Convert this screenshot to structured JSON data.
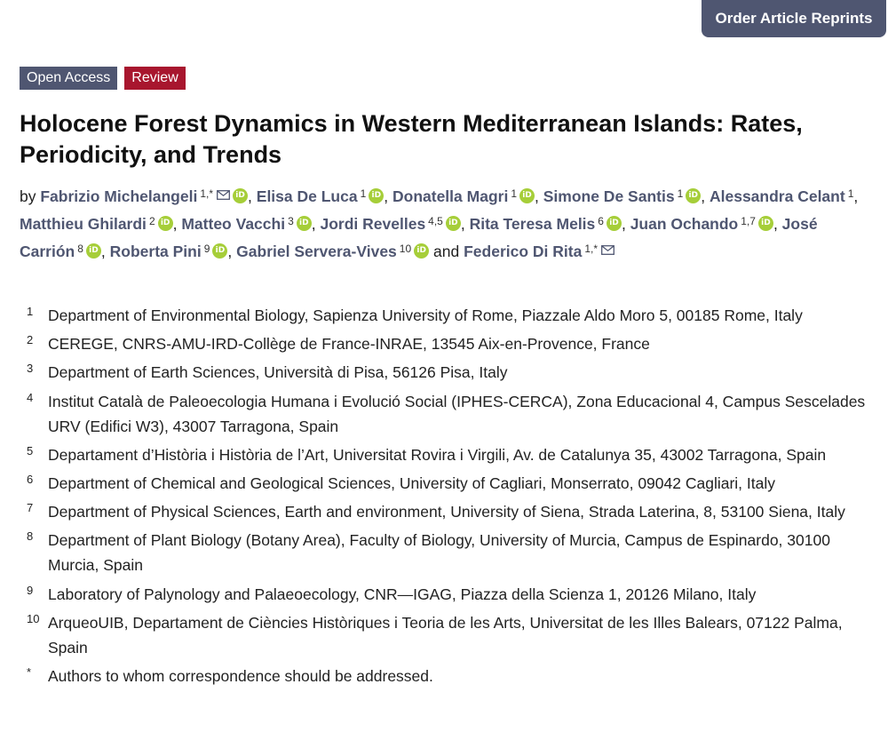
{
  "header": {
    "reprint_label": "Order Article Reprints"
  },
  "badges": {
    "open_access": "Open Access",
    "type": "Review"
  },
  "colors": {
    "accent": "#4f5671",
    "review": "#a8162e",
    "orcid": "#a6ce39"
  },
  "title": "Holocene Forest Dynamics in Western Mediterranean Islands: Rates, Periodicity, and Trends",
  "authors": {
    "by": "by",
    "and": "and",
    "list": [
      {
        "name": "Fabrizio Michelangeli",
        "sup": "1,*",
        "email": true,
        "orcid": true
      },
      {
        "name": "Elisa De Luca",
        "sup": "1",
        "email": false,
        "orcid": true
      },
      {
        "name": "Donatella Magri",
        "sup": "1",
        "email": false,
        "orcid": true
      },
      {
        "name": "Simone De Santis",
        "sup": "1",
        "email": false,
        "orcid": true
      },
      {
        "name": "Alessandra Celant",
        "sup": "1",
        "email": false,
        "orcid": false
      },
      {
        "name": "Matthieu Ghilardi",
        "sup": "2",
        "email": false,
        "orcid": true
      },
      {
        "name": "Matteo Vacchi",
        "sup": "3",
        "email": false,
        "orcid": true
      },
      {
        "name": "Jordi Revelles",
        "sup": "4,5",
        "email": false,
        "orcid": true
      },
      {
        "name": "Rita Teresa Melis",
        "sup": "6",
        "email": false,
        "orcid": true
      },
      {
        "name": "Juan Ochando",
        "sup": "1,7",
        "email": false,
        "orcid": true
      },
      {
        "name": "José Carrión",
        "sup": "8",
        "email": false,
        "orcid": true
      },
      {
        "name": "Roberta Pini",
        "sup": "9",
        "email": false,
        "orcid": true
      },
      {
        "name": "Gabriel Servera-Vives",
        "sup": "10",
        "email": false,
        "orcid": true
      },
      {
        "name": "Federico Di Rita",
        "sup": "1,*",
        "email": true,
        "orcid": false
      }
    ]
  },
  "icons": {
    "orcid": "orcid-icon",
    "email": "envelope-icon"
  },
  "affiliations": [
    {
      "num": "1",
      "text": "Department of Environmental Biology, Sapienza University of Rome, Piazzale Aldo Moro 5, 00185 Rome, Italy"
    },
    {
      "num": "2",
      "text": "CEREGE, CNRS-AMU-IRD-Collège de France-INRAE, 13545 Aix-en-Provence, France"
    },
    {
      "num": "3",
      "text": "Department of Earth Sciences, Università di Pisa, 56126 Pisa, Italy"
    },
    {
      "num": "4",
      "text": "Institut Català de Paleoecologia Humana i Evolució Social (IPHES-CERCA), Zona Educacional 4, Campus Sescelades URV (Edifici W3), 43007 Tarragona, Spain"
    },
    {
      "num": "5",
      "text": "Departament d’Història i Història de l’Art, Universitat Rovira i Virgili, Av. de Catalunya 35, 43002 Tarragona, Spain"
    },
    {
      "num": "6",
      "text": "Department of Chemical and Geological Sciences, University of Cagliari, Monserrato, 09042 Cagliari, Italy"
    },
    {
      "num": "7",
      "text": "Department of Physical Sciences, Earth and environment, University of Siena, Strada Laterina, 8, 53100 Siena, Italy"
    },
    {
      "num": "8",
      "text": "Department of Plant Biology (Botany Area), Faculty of Biology, University of Murcia, Campus de Espinardo, 30100 Murcia, Spain"
    },
    {
      "num": "9",
      "text": "Laboratory of Palynology and Palaeoecology, CNR—IGAG, Piazza della Scienza 1, 20126 Milano, Italy"
    },
    {
      "num": "10",
      "text": "ArqueoUIB, Departament de Ciències Històriques i Teoria de les Arts, Universitat de les Illes Balears, 07122 Palma, Spain"
    },
    {
      "num": "*",
      "text": "Authors to whom correspondence should be addressed."
    }
  ]
}
